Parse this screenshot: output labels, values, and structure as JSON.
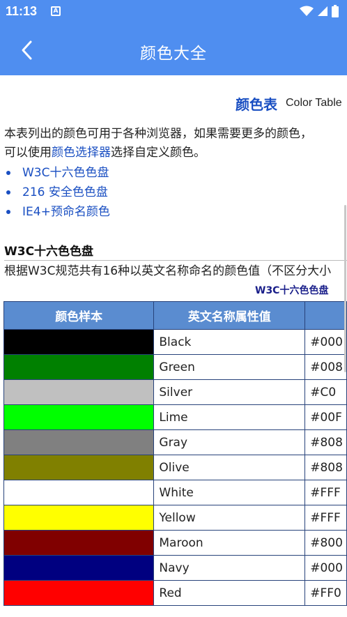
{
  "status_bar": {
    "time": "11:13",
    "a_icon": "A"
  },
  "app_bar": {
    "title": "颜色大全",
    "back_icon": "chevron-left"
  },
  "page": {
    "heading_cn": "颜色表",
    "heading_en": "Color Table",
    "intro_line1": "本表列出的颜色可用于各种浏览器，如果需要更多的颜色，",
    "intro_line2_pre": "可以使用",
    "intro_link": "颜色选择器",
    "intro_line2_post": "选择自定义颜色。",
    "links": [
      "W3C十六色色盘",
      "216 安全色色盘",
      "IE4+预命名颜色"
    ],
    "section_title": "W3C十六色色盘",
    "section_desc": "根据W3C规范共有16种以英文名称命名的颜色值（不区分大小",
    "table_caption": "W3C十六色色盘",
    "table": {
      "headers": [
        "颜色样本",
        "英文名称属性值",
        ""
      ],
      "rows": [
        {
          "color": "#000000",
          "name": "Black",
          "value": "#000"
        },
        {
          "color": "#008000",
          "name": "Green",
          "value": "#008"
        },
        {
          "color": "#C0C0C0",
          "name": "Silver",
          "value": "#C0"
        },
        {
          "color": "#00FF00",
          "name": "Lime",
          "value": "#00F"
        },
        {
          "color": "#808080",
          "name": "Gray",
          "value": "#808"
        },
        {
          "color": "#808000",
          "name": "Olive",
          "value": "#808"
        },
        {
          "color": "#FFFFFF",
          "name": "White",
          "value": "#FFF"
        },
        {
          "color": "#FFFF00",
          "name": "Yellow",
          "value": "#FFF"
        },
        {
          "color": "#800000",
          "name": "Maroon",
          "value": "#800"
        },
        {
          "color": "#000080",
          "name": "Navy",
          "value": "#000"
        },
        {
          "color": "#FF0000",
          "name": "Red",
          "value": "#FF0"
        }
      ]
    }
  },
  "colors": {
    "accent": "#4f8ef0",
    "link": "#1a4fc2",
    "table_header": "#5a8cd0",
    "table_border": "#27427a"
  }
}
